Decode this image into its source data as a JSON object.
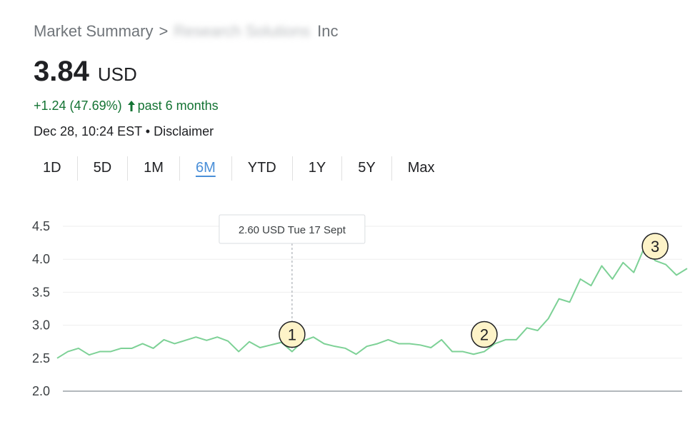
{
  "breadcrumb": {
    "root": "Market Summary",
    "separator": ">",
    "company_blurred": "Research Solutions",
    "company_suffix": "Inc"
  },
  "quote": {
    "price": "3.84",
    "currency": "USD",
    "change": "+1.24 (47.69%)",
    "period": "past 6 months",
    "date": "Dec 28, 10:24 EST",
    "bullet": "•",
    "disclaimer": "Disclaimer"
  },
  "tabs": [
    {
      "label": "1D"
    },
    {
      "label": "5D"
    },
    {
      "label": "1M"
    },
    {
      "label": "6M",
      "active": true
    },
    {
      "label": "YTD"
    },
    {
      "label": "1Y"
    },
    {
      "label": "5Y"
    },
    {
      "label": "Max"
    }
  ],
  "colors": {
    "line": "#7dd196",
    "positive": "#137333",
    "active_tab": "#4a8fd8",
    "marker_fill": "#fdf3c8"
  },
  "chart_data": {
    "type": "line",
    "y_ticks": [
      "4.5",
      "4.0",
      "3.5",
      "3.0",
      "2.5",
      "2.0"
    ],
    "ylim": [
      2.0,
      4.5
    ],
    "values": [
      2.5,
      2.6,
      2.65,
      2.55,
      2.6,
      2.6,
      2.65,
      2.65,
      2.72,
      2.65,
      2.78,
      2.72,
      2.77,
      2.82,
      2.77,
      2.82,
      2.76,
      2.6,
      2.75,
      2.66,
      2.7,
      2.74,
      2.6,
      2.76,
      2.82,
      2.72,
      2.68,
      2.65,
      2.56,
      2.68,
      2.72,
      2.78,
      2.72,
      2.72,
      2.7,
      2.66,
      2.78,
      2.6,
      2.6,
      2.56,
      2.6,
      2.72,
      2.78,
      2.78,
      2.96,
      2.92,
      3.1,
      3.4,
      3.35,
      3.7,
      3.6,
      3.9,
      3.7,
      3.95,
      3.8,
      4.18,
      3.98,
      3.92,
      3.76,
      3.86
    ],
    "tooltip": "2.60 USD Tue 17 Sept",
    "tooltip_index": 22,
    "markers": [
      {
        "label": "1",
        "index": 22
      },
      {
        "label": "2",
        "index": 40
      },
      {
        "label": "3",
        "index": 56
      }
    ]
  }
}
